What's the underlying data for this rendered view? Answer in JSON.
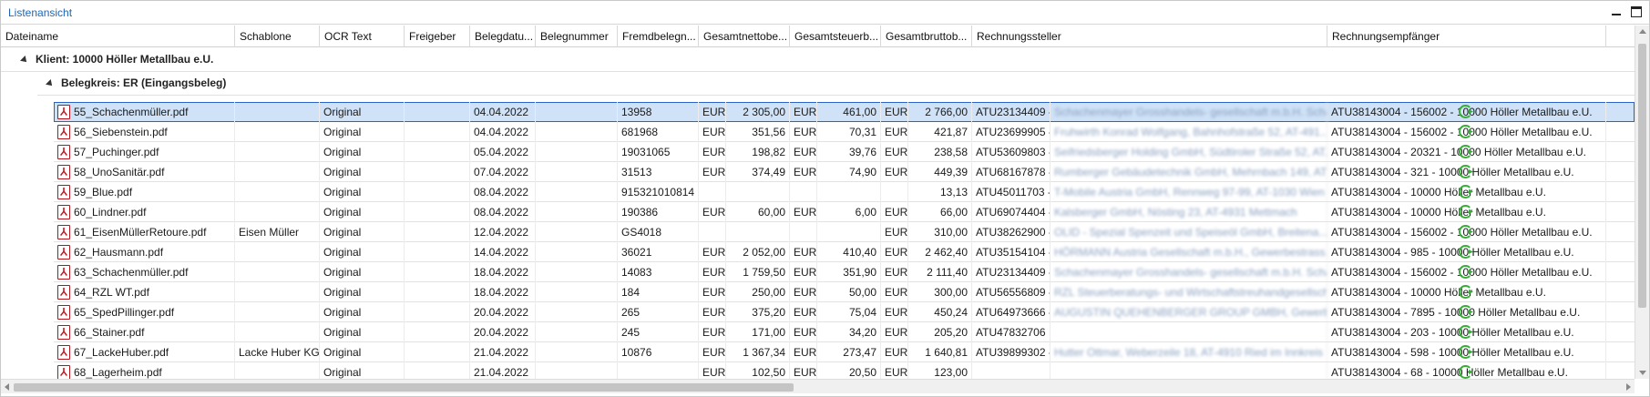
{
  "window": {
    "title": "Listenansicht"
  },
  "columns": [
    "Dateiname",
    "Schablone",
    "OCR Text",
    "Freigeber",
    "Belegdatu...",
    "Belegnummer",
    "Fremdbelegn...",
    "Gesamtnettobe...",
    "Gesamtsteuerb...",
    "Gesamtbruttob...",
    "Rechnungssteller",
    "Rechnungsempfänger"
  ],
  "group1": "Klient: 10000 Höller Metallbau e.U.",
  "group2": "Belegkreis: ER (Eingangsbeleg)",
  "rows": [
    {
      "file": "55_Schachenmüller.pdf",
      "schablone": "",
      "ocr": "Original",
      "datum": "04.04.2022",
      "fremd": "13958",
      "c1": "EUR",
      "netto": "2 305,00",
      "c2": "EUR",
      "steuer": "461,00",
      "c3": "EUR",
      "brutto": "2 766,00",
      "steller_id": "ATU23134409 -",
      "steller_name": "Schachenmayer Grosshandels- gesellschaft m.b.H. Scha...",
      "empf": "ATU38143004 - 156002 - 10000 Höller Metallbau e.U."
    },
    {
      "file": "56_Siebenstein.pdf",
      "schablone": "",
      "ocr": "Original",
      "datum": "04.04.2022",
      "fremd": "681968",
      "c1": "EUR",
      "netto": "351,56",
      "c2": "EUR",
      "steuer": "70,31",
      "c3": "EUR",
      "brutto": "421,87",
      "steller_id": "ATU23699905 -",
      "steller_name": "Fruhwirth Konrad Wolfgang, Bahnhofstraße 52, AT-491...",
      "empf": "ATU38143004 - 156002 - 10000 Höller Metallbau e.U."
    },
    {
      "file": "57_Puchinger.pdf",
      "schablone": "",
      "ocr": "Original",
      "datum": "05.04.2022",
      "fremd": "19031065",
      "c1": "EUR",
      "netto": "198,82",
      "c2": "EUR",
      "steuer": "39,76",
      "c3": "EUR",
      "brutto": "238,58",
      "steller_id": "ATU53609803 -",
      "steller_name": "Seifriedsberger Holding GmbH, Südtiroler Straße 52, AT...",
      "empf": "ATU38143004 - 20321 - 10000 Höller Metallbau e.U."
    },
    {
      "file": "58_UnoSanitär.pdf",
      "schablone": "",
      "ocr": "Original",
      "datum": "07.04.2022",
      "fremd": "31513",
      "c1": "EUR",
      "netto": "374,49",
      "c2": "EUR",
      "steuer": "74,90",
      "c3": "EUR",
      "brutto": "449,39",
      "steller_id": "ATU68167878 -",
      "steller_name": "Rumberger Gebäudetechnik GmbH, Mehrnbach 149, AT...",
      "empf": "ATU38143004 - 321 - 10000 Höller Metallbau e.U."
    },
    {
      "file": "59_Blue.pdf",
      "schablone": "",
      "ocr": "Original",
      "datum": "08.04.2022",
      "fremd": "915321010814",
      "c1": "",
      "netto": "",
      "c2": "",
      "steuer": "",
      "c3": "",
      "brutto": "13,13",
      "steller_id": "ATU45011703 -",
      "steller_name": "T-Mobile Austria GmbH, Rennweg 97-99, AT-1030 Wien",
      "empf": "ATU38143004 - 10000 Höller Metallbau e.U."
    },
    {
      "file": "60_Lindner.pdf",
      "schablone": "",
      "ocr": "Original",
      "datum": "08.04.2022",
      "fremd": "190386",
      "c1": "EUR",
      "netto": "60,00",
      "c2": "EUR",
      "steuer": "6,00",
      "c3": "EUR",
      "brutto": "66,00",
      "steller_id": "ATU69074404 -",
      "steller_name": "Kalsberger GmbH, Nösting 23, AT-4931 Mettmach",
      "empf": "ATU38143004 - 10000 Höller Metallbau e.U."
    },
    {
      "file": "61_EisenMüllerRetoure.pdf",
      "schablone": "Eisen Müller",
      "ocr": "Original",
      "datum": "12.04.2022",
      "fremd": "GS4018",
      "c1": "",
      "netto": "",
      "c2": "",
      "steuer": "",
      "c3": "EUR",
      "brutto": "310,00",
      "steller_id": "ATU38262900 -",
      "steller_name": "OLID - Spezial Spenzeit und Speiseöl GmbH, Breitena...",
      "empf": "ATU38143004 - 156002 - 10000 Höller Metallbau e.U."
    },
    {
      "file": "62_Hausmann.pdf",
      "schablone": "",
      "ocr": "Original",
      "datum": "14.04.2022",
      "fremd": "36021",
      "c1": "EUR",
      "netto": "2 052,00",
      "c2": "EUR",
      "steuer": "410,40",
      "c3": "EUR",
      "brutto": "2 462,40",
      "steller_id": "ATU35154104 -",
      "steller_name": "HÖRMANN Austria Gesellschaft m.b.H., Gewerbestrass...",
      "empf": "ATU38143004 - 985 - 10000 Höller Metallbau e.U."
    },
    {
      "file": "63_Schachenmüller.pdf",
      "schablone": "",
      "ocr": "Original",
      "datum": "18.04.2022",
      "fremd": "14083",
      "c1": "EUR",
      "netto": "1 759,50",
      "c2": "EUR",
      "steuer": "351,90",
      "c3": "EUR",
      "brutto": "2 111,40",
      "steller_id": "ATU23134409 -",
      "steller_name": "Schachenmayer Grosshandels- gesellschaft m.b.H. Scha...",
      "empf": "ATU38143004 - 156002 - 10000 Höller Metallbau e.U."
    },
    {
      "file": "64_RZL WT.pdf",
      "schablone": "",
      "ocr": "Original",
      "datum": "18.04.2022",
      "fremd": "184",
      "c1": "EUR",
      "netto": "250,00",
      "c2": "EUR",
      "steuer": "50,00",
      "c3": "EUR",
      "brutto": "300,00",
      "steller_id": "ATU56556809 -",
      "steller_name": "RZL Steuerberatungs- und Wirtschaftstreuhandgesellsch...",
      "empf": "ATU38143004 - 10000 Höller Metallbau e.U."
    },
    {
      "file": "65_SpedPillinger.pdf",
      "schablone": "",
      "ocr": "Original",
      "datum": "20.04.2022",
      "fremd": "265",
      "c1": "EUR",
      "netto": "375,20",
      "c2": "EUR",
      "steuer": "75,04",
      "c3": "EUR",
      "brutto": "450,24",
      "steller_id": "ATU64973666 -",
      "steller_name": "AUGUSTIN QUEHENBERGER GROUP GMBH, Gewerbeg...",
      "empf": "ATU38143004 - 7895 - 10000 Höller Metallbau e.U."
    },
    {
      "file": "66_Stainer.pdf",
      "schablone": "",
      "ocr": "Original",
      "datum": "20.04.2022",
      "fremd": "245",
      "c1": "EUR",
      "netto": "171,00",
      "c2": "EUR",
      "steuer": "34,20",
      "c3": "EUR",
      "brutto": "205,20",
      "steller_id": "ATU47832706",
      "steller_name": "",
      "empf": "ATU38143004 - 203 - 10000 Höller Metallbau e.U."
    },
    {
      "file": "67_LackeHuber.pdf",
      "schablone": "Lacke Huber KG",
      "ocr": "Original",
      "datum": "21.04.2022",
      "fremd": "10876",
      "c1": "EUR",
      "netto": "1 367,34",
      "c2": "EUR",
      "steuer": "273,47",
      "c3": "EUR",
      "brutto": "1 640,81",
      "steller_id": "ATU39899302 -",
      "steller_name": "Hutter Ottmar, Weberzeile 18, AT-4910 Ried im Innkreis",
      "empf": "ATU38143004 - 598 - 10000 Höller Metallbau e.U."
    },
    {
      "file": "68_Lagerheim.pdf",
      "schablone": "",
      "ocr": "Original",
      "datum": "21.04.2022",
      "fremd": "",
      "c1": "EUR",
      "netto": "102,50",
      "c2": "EUR",
      "steuer": "20,50",
      "c3": "EUR",
      "brutto": "123,00",
      "steller_id": "",
      "steller_name": "",
      "empf": "ATU38143004 - 68 - 10000 Höller Metallbau e.U."
    }
  ],
  "colors": {
    "title": "#1c66b5",
    "selection": "#cfe2f7",
    "pdf_red": "#c8141e",
    "sync_green": "#3aaa3a"
  },
  "icons": {
    "file": "pdf-icon",
    "status": "sync-icon"
  }
}
